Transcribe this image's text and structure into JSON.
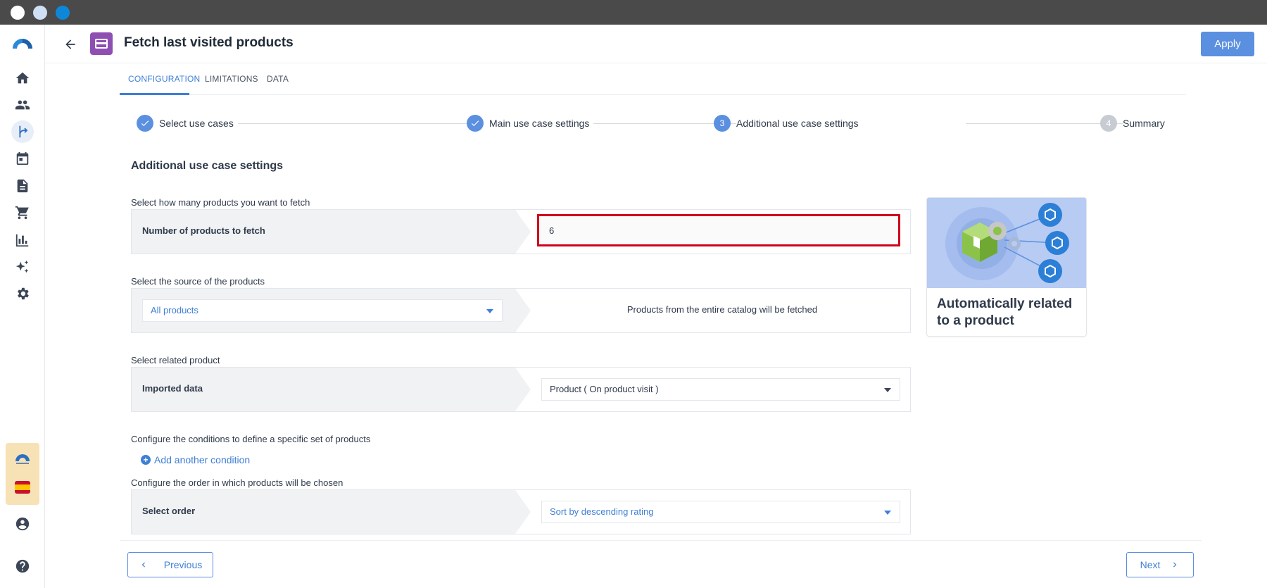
{
  "window": {
    "title": "Fetch last visited products"
  },
  "header": {
    "title": "Fetch last visited products",
    "apply_label": "Apply"
  },
  "tabs": [
    {
      "label": "CONFIGURATION",
      "active": true
    },
    {
      "label": "LIMITATIONS",
      "active": false
    },
    {
      "label": "DATA",
      "active": false
    }
  ],
  "stepper": {
    "steps": [
      {
        "label": "Select use cases",
        "state": "done",
        "number": ""
      },
      {
        "label": "Main use case settings",
        "state": "done",
        "number": ""
      },
      {
        "label": "Additional use case settings",
        "state": "current",
        "number": "3"
      },
      {
        "label": "Summary",
        "state": "todo",
        "number": "4"
      }
    ]
  },
  "section": {
    "title": "Additional use case settings"
  },
  "fetch_count": {
    "label": "Select how many products you want to fetch",
    "row_label": "Number of products to fetch",
    "value": "6"
  },
  "source": {
    "label": "Select the source of the products",
    "selected": "All products",
    "info": "Products from the entire catalog will be fetched"
  },
  "related": {
    "label": "Select related product",
    "row_label": "Imported data",
    "selected": "Product ( On product visit )"
  },
  "conditions": {
    "label": "Configure the conditions to define a specific set of products",
    "add_label": "Add another condition"
  },
  "order": {
    "label": "Configure the order in which products will be chosen",
    "row_label": "Select order",
    "selected": "Sort by descending rating"
  },
  "info_card": {
    "caption": "Automatically related to a product"
  },
  "footer": {
    "previous_label": "Previous",
    "next_label": "Next"
  },
  "colors": {
    "accent": "#5b8fe0",
    "highlight_border": "#d0021b",
    "node_icon": "#8e4fb3"
  }
}
